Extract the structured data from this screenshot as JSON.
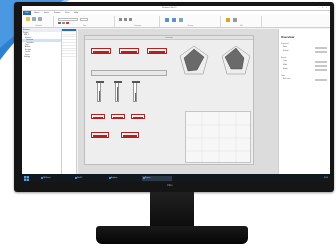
{
  "app": {
    "title": "Siemens WinCC",
    "window_buttons": "– □ ×"
  },
  "menu": {
    "file": "File",
    "tabs": [
      "Home",
      "Insert",
      "Format",
      "View",
      "Help"
    ]
  },
  "ribbon": {
    "groups": [
      "Clipboard",
      "Font",
      "Paragraph",
      "Arrange",
      "Edit"
    ]
  },
  "tree": {
    "header": "Screens",
    "items": [
      "Project",
      "HMI_1",
      "Screens",
      "Overview",
      "Templates",
      "Tags",
      "Alarms",
      "Recipes",
      "Trends",
      "Users",
      "Settings"
    ]
  },
  "middle_items": [
    "Basic objects",
    "Elements",
    "Controls",
    "Graphics",
    "",
    "",
    "",
    "",
    "",
    ""
  ],
  "canvas": {
    "screen_title": "Overview"
  },
  "properties": {
    "title": "Overview",
    "sections": [
      "Properties",
      "Events",
      "Texts"
    ],
    "rows": [
      "Name",
      "Number",
      "Layer",
      "Width",
      "Height",
      "Back color"
    ]
  },
  "taskbar": {
    "items": [
      "TIA Portal",
      "WinCC",
      "Explorer",
      "Screen"
    ],
    "clock": "10:24"
  },
  "brand": {
    "logo": "DELL"
  },
  "colors": {
    "accent": "#2b6cb0",
    "alarm_red": "#b32020",
    "swoosh": "#2f7fd3"
  }
}
